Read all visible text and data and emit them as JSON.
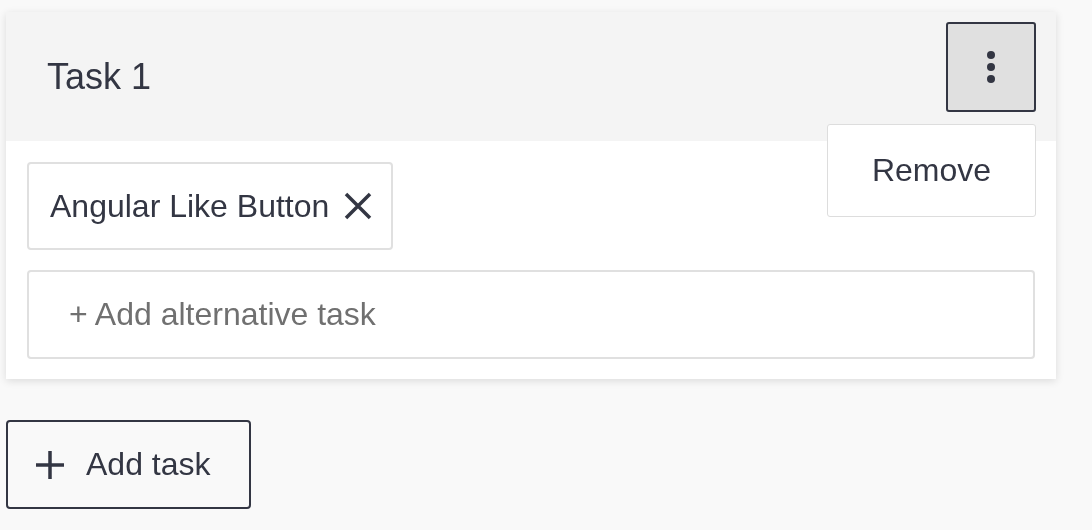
{
  "task": {
    "title": "Task 1",
    "menu": {
      "expanded": true,
      "items": [
        {
          "label": "Remove"
        }
      ]
    },
    "chips": [
      {
        "label": "Angular Like Button"
      }
    ],
    "alternative_field": {
      "placeholder": "+ Add alternative task"
    }
  },
  "add_button": {
    "label": "Add task"
  }
}
